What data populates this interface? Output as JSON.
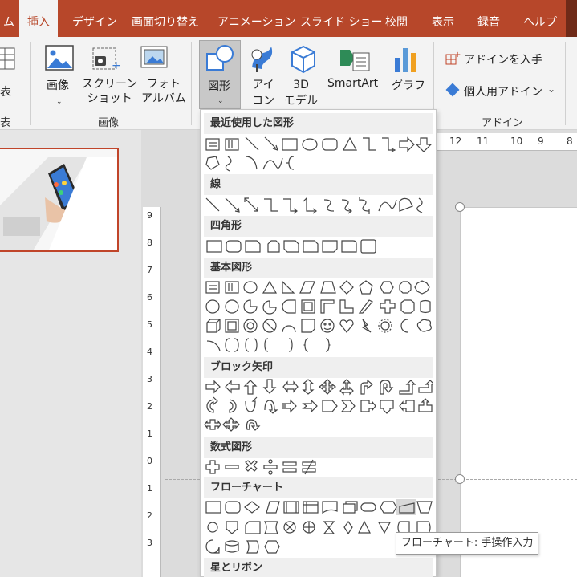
{
  "tabs": [
    {
      "label": "ム"
    },
    {
      "label": "挿入"
    },
    {
      "label": "デザイン"
    },
    {
      "label": "画面切り替え"
    },
    {
      "label": "アニメーション"
    },
    {
      "label": "スライド ショー"
    },
    {
      "label": "校閲"
    },
    {
      "label": "表示"
    },
    {
      "label": "録音"
    },
    {
      "label": "ヘルプ"
    }
  ],
  "ribbon": {
    "table_partial": "表",
    "table_group_partial": "表",
    "image_label": "画像",
    "screenshot_label": "スクリーン\nショット",
    "photo_album_label": "フォト\nアルバム",
    "images_group": "画像",
    "shapes_label": "図形",
    "icons_label": "アイ\nコン",
    "model3d_label": "3D\nモデル",
    "smartart_label": "SmartArt",
    "chart_label": "グラフ",
    "get_addins_label": "アドインを入手",
    "my_addins_label": "個人用アドイン",
    "addins_group": "アドイン"
  },
  "ruler": {
    "h_ticks": [
      "12",
      "11",
      "10",
      "9",
      "8"
    ],
    "v_ticks": [
      "9",
      "8",
      "7",
      "6",
      "5",
      "4",
      "3",
      "2",
      "1",
      "0",
      "1",
      "2",
      "3"
    ]
  },
  "dropdown": {
    "sections": [
      {
        "title": "最近使用した図形"
      },
      {
        "title": "線"
      },
      {
        "title": "四角形"
      },
      {
        "title": "基本図形"
      },
      {
        "title": "ブロック矢印"
      },
      {
        "title": "数式図形"
      },
      {
        "title": "フローチャート"
      },
      {
        "title": "星とリボン"
      }
    ]
  },
  "tooltip": "フローチャート: 手操作入力",
  "colors": {
    "accent": "#b7472a",
    "ribbon_bg": "#f3f3f3"
  }
}
